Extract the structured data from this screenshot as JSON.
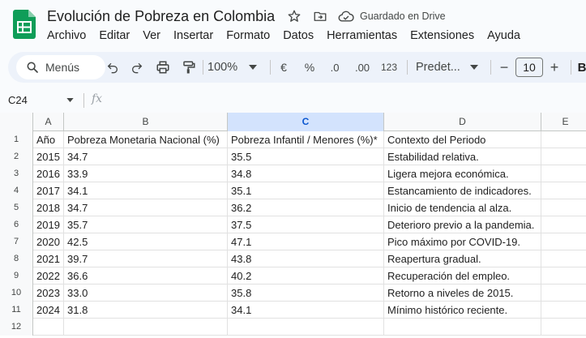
{
  "app": {
    "title": "Evolución de Pobreza en Colombia",
    "saved_status": "Guardado en Drive",
    "brand_color": "#0f9d58"
  },
  "menu": [
    "Archivo",
    "Editar",
    "Ver",
    "Insertar",
    "Formato",
    "Datos",
    "Herramientas",
    "Extensiones",
    "Ayuda"
  ],
  "toolbar": {
    "search_label": "Menús",
    "zoom": "100%",
    "currency": "€",
    "percent": "%",
    "decrease_decimals": ".0",
    "increase_decimals": ".00",
    "number_format": "123",
    "font_name": "Predet...",
    "font_size": "10",
    "minus": "−",
    "plus": "+",
    "bold": "B"
  },
  "formula_bar": {
    "cell_ref": "C24",
    "fx": "fx"
  },
  "sheet": {
    "column_headers": [
      "A",
      "B",
      "C",
      "D",
      "E"
    ],
    "selected_column": "C",
    "row_numbers": [
      "1",
      "2",
      "3",
      "4",
      "5",
      "6",
      "7",
      "8",
      "9",
      "10",
      "11",
      "12"
    ],
    "rows": [
      [
        "Año",
        "Pobreza Monetaria Nacional (%)",
        "Pobreza Infantil / Menores (%)*",
        "Contexto del Periodo"
      ],
      [
        "2015",
        "34.7",
        "35.5",
        "Estabilidad relativa."
      ],
      [
        "2016",
        "33.9",
        "34.8",
        "Ligera mejora económica."
      ],
      [
        "2017",
        "34.1",
        "35.1",
        "Estancamiento de indicadores."
      ],
      [
        "2018",
        "34.7",
        "36.2",
        "Inicio de tendencia al alza."
      ],
      [
        "2019",
        "35.7",
        "37.5",
        "Deterioro previo a la pandemia."
      ],
      [
        "2020",
        "42.5",
        "47.1",
        "Pico máximo por COVID-19."
      ],
      [
        "2021",
        "39.7",
        "43.8",
        "Reapertura gradual."
      ],
      [
        "2022",
        "36.6",
        "40.2",
        "Recuperación del empleo."
      ],
      [
        "2023",
        "33.0",
        "35.8",
        "Retorno a niveles de 2015."
      ],
      [
        "2024",
        "31.8",
        "34.1",
        "Mínimo histórico reciente."
      ],
      [
        "",
        "",
        "",
        ""
      ]
    ]
  }
}
